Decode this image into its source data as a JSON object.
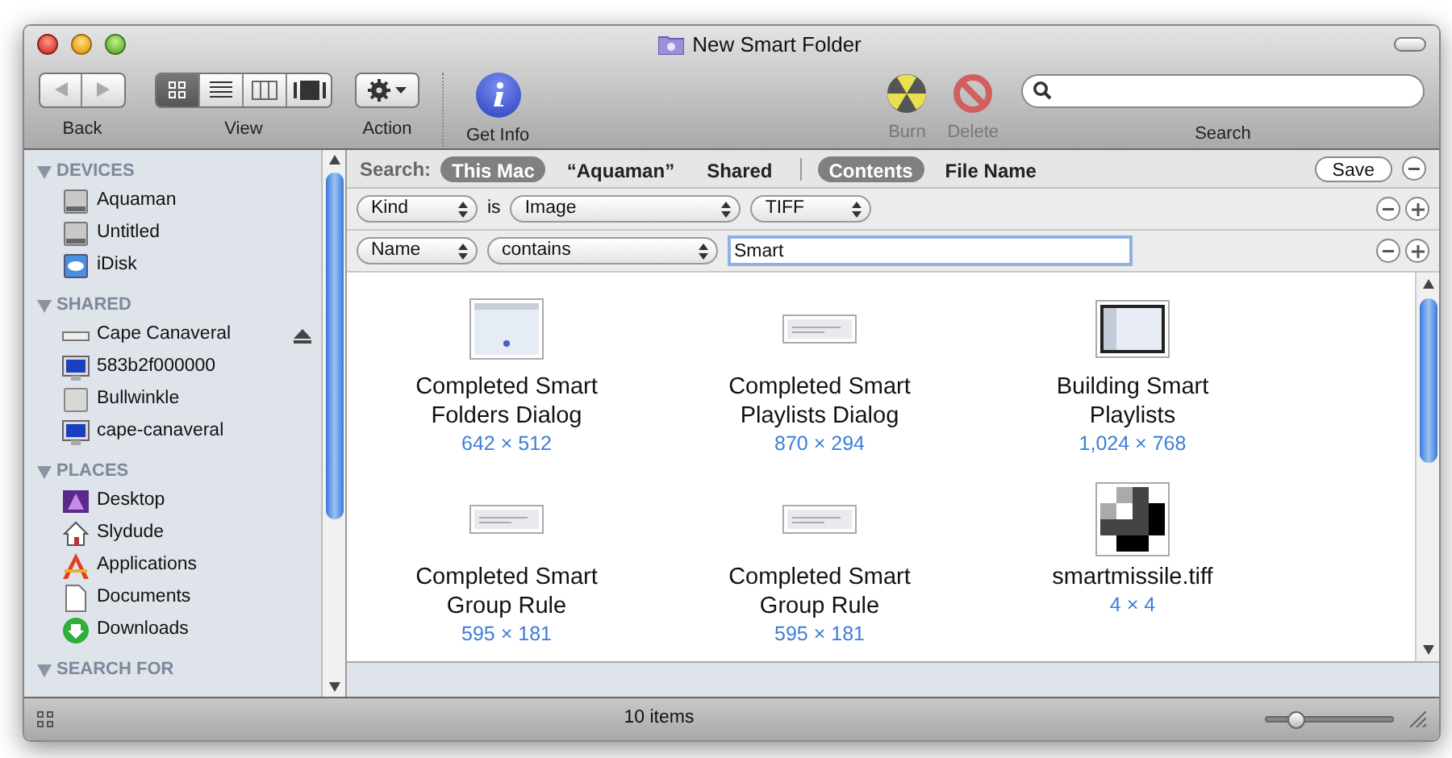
{
  "window": {
    "title": "New Smart Folder"
  },
  "toolbar": {
    "back_label": "Back",
    "view_label": "View",
    "view_modes": [
      {
        "kind": "icon",
        "selected": true
      },
      {
        "kind": "list",
        "selected": false
      },
      {
        "kind": "columns",
        "selected": false
      },
      {
        "kind": "coverflow",
        "selected": false
      }
    ],
    "action_label": "Action",
    "get_info_label": "Get Info",
    "burn_label": "Burn",
    "delete_label": "Delete",
    "search_label": "Search"
  },
  "sidebar": {
    "sections": [
      {
        "title": "DEVICES",
        "items": [
          {
            "label": "Aquaman",
            "kind": "disk"
          },
          {
            "label": "Untitled",
            "kind": "disk"
          },
          {
            "label": "iDisk",
            "kind": "idisk"
          }
        ]
      },
      {
        "title": "SHARED",
        "items": [
          {
            "label": "Cape Canaveral",
            "kind": "server",
            "eject": true
          },
          {
            "label": "583b2f000000",
            "kind": "monitor"
          },
          {
            "label": "Bullwinkle",
            "kind": "macmini"
          },
          {
            "label": "cape-canaveral",
            "kind": "monitor"
          }
        ]
      },
      {
        "title": "PLACES",
        "items": [
          {
            "label": "Desktop",
            "kind": "desktop"
          },
          {
            "label": "Slydude",
            "kind": "home"
          },
          {
            "label": "Applications",
            "kind": "apps"
          },
          {
            "label": "Documents",
            "kind": "document"
          },
          {
            "label": "Downloads",
            "kind": "download"
          }
        ]
      },
      {
        "title": "SEARCH FOR"
      }
    ]
  },
  "search_bar": {
    "label": "Search:",
    "scopes": [
      {
        "label": "This Mac",
        "selected": true
      },
      {
        "label": "“Aquaman”",
        "selected": false
      },
      {
        "label": "Shared",
        "selected": false
      }
    ],
    "fields": [
      {
        "label": "Contents",
        "selected": true
      },
      {
        "label": "File Name",
        "selected": false
      }
    ],
    "save": "Save"
  },
  "criteria": [
    {
      "parts": [
        {
          "kind": "popup",
          "value": "Kind"
        },
        {
          "kind": "text",
          "value": "is"
        },
        {
          "kind": "longpopup",
          "value": "Image"
        },
        {
          "kind": "popup",
          "value": "TIFF"
        }
      ]
    },
    {
      "parts": [
        {
          "kind": "popup",
          "value": "Name"
        },
        {
          "kind": "longpopup",
          "value": "contains"
        },
        {
          "kind": "field",
          "value": "Smart"
        }
      ]
    }
  ],
  "files": [
    {
      "name": "Completed Smart Folders Dialog",
      "size": "642 × 512",
      "kind": "tall"
    },
    {
      "name": "Completed Smart Playlists Dialog",
      "size": "870 × 294",
      "kind": "wide"
    },
    {
      "name": "Building Smart Playlists",
      "size": "1,024 × 768",
      "kind": "dark"
    },
    {
      "name": "Completed Smart Group Rule",
      "size": "595 × 181",
      "kind": "wide"
    },
    {
      "name": "Completed Smart Group Rule",
      "size": "595 × 181",
      "kind": "wide"
    },
    {
      "name": "smartmissile.tiff",
      "size": "4 × 4",
      "kind": "pixels"
    }
  ],
  "status_bar": {
    "text": "10 items",
    "zoom": {
      "level": 0.2
    }
  }
}
